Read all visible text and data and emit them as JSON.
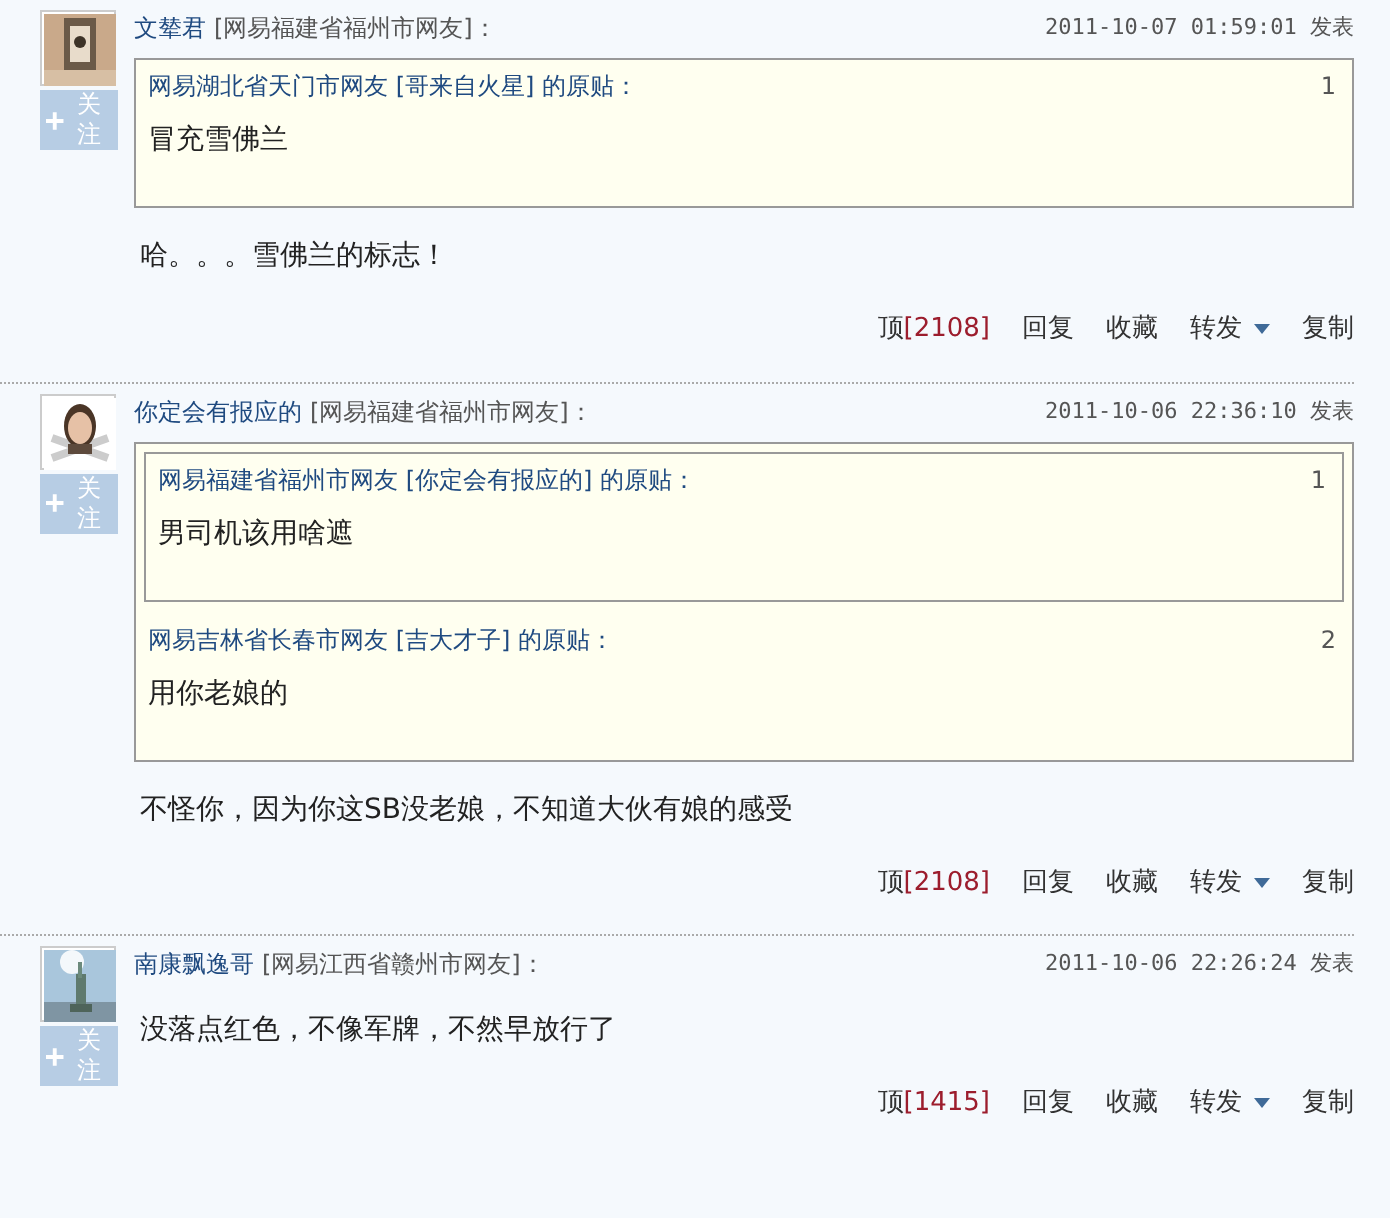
{
  "posts": [
    {
      "user": "文辇君",
      "location": "[网易福建省福州市网友]：",
      "time": "2011-10-07 01:59:01 发表",
      "follow": "关注",
      "quote": {
        "header": "网易湖北省天门市网友 [哥来自火星] 的原贴：",
        "number": "1",
        "text": "冒充雪佛兰"
      },
      "text": "哈。。。雪佛兰的标志！",
      "actions": {
        "up": "顶",
        "up_count": "[2108]",
        "reply": "回复",
        "favorite": "收藏",
        "forward": "转发",
        "copy": "复制"
      }
    },
    {
      "user": "你定会有报应的",
      "location": "[网易福建省福州市网友]：",
      "time": "2011-10-06 22:36:10 发表",
      "follow": "关注",
      "quote": {
        "header": "网易吉林省长春市网友 [吉大才子] 的原贴：",
        "number": "2",
        "text": "用你老娘的",
        "quote": {
          "header": "网易福建省福州市网友 [你定会有报应的] 的原贴：",
          "number": "1",
          "text": "男司机该用啥遮"
        }
      },
      "text": "不怪你，因为你这SB没老娘，不知道大伙有娘的感受",
      "actions": {
        "up": "顶",
        "up_count": "[2108]",
        "reply": "回复",
        "favorite": "收藏",
        "forward": "转发",
        "copy": "复制"
      }
    },
    {
      "user": "南康飘逸哥",
      "location": "[网易江西省赣州市网友]：",
      "time": "2011-10-06 22:26:24 发表",
      "follow": "关注",
      "text": "没落点红色，不像军牌，不然早放行了",
      "actions": {
        "up": "顶",
        "up_count": "[1415]",
        "reply": "回复",
        "favorite": "收藏",
        "forward": "转发",
        "copy": "复制"
      }
    }
  ]
}
